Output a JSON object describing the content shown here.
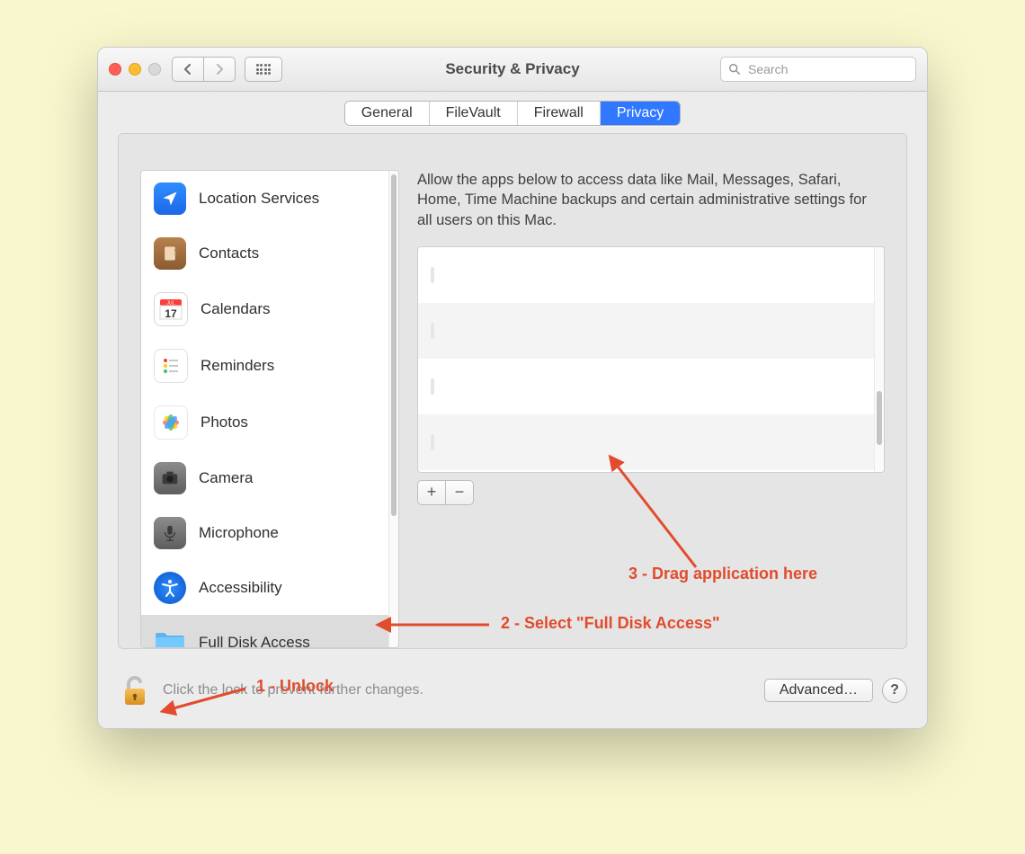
{
  "window": {
    "title": "Security & Privacy",
    "search_placeholder": "Search"
  },
  "tabs": [
    {
      "label": "General"
    },
    {
      "label": "FileVault"
    },
    {
      "label": "Firewall"
    },
    {
      "label": "Privacy",
      "active": true
    }
  ],
  "privacy": {
    "description": "Allow the apps below to access data like Mail, Messages, Safari, Home, Time Machine backups and certain administrative settings for all users on this Mac."
  },
  "sidebar": {
    "items": [
      {
        "label": "Location Services",
        "icon": "location"
      },
      {
        "label": "Contacts",
        "icon": "contacts"
      },
      {
        "label": "Calendars",
        "icon": "calendar"
      },
      {
        "label": "Reminders",
        "icon": "reminders"
      },
      {
        "label": "Photos",
        "icon": "photos"
      },
      {
        "label": "Camera",
        "icon": "camera"
      },
      {
        "label": "Microphone",
        "icon": "mic"
      },
      {
        "label": "Accessibility",
        "icon": "accessibility"
      },
      {
        "label": "Full Disk Access",
        "icon": "folder",
        "selected": true
      }
    ]
  },
  "footer": {
    "lock_text": "Click the lock to prevent further changes.",
    "advanced": "Advanced…",
    "help": "?"
  },
  "buttons": {
    "plus": "+",
    "minus": "−"
  },
  "annotations": {
    "a1": "1 - Unlock",
    "a2": "2 - Select \"Full Disk Access\"",
    "a3": "3 - Drag application here"
  }
}
